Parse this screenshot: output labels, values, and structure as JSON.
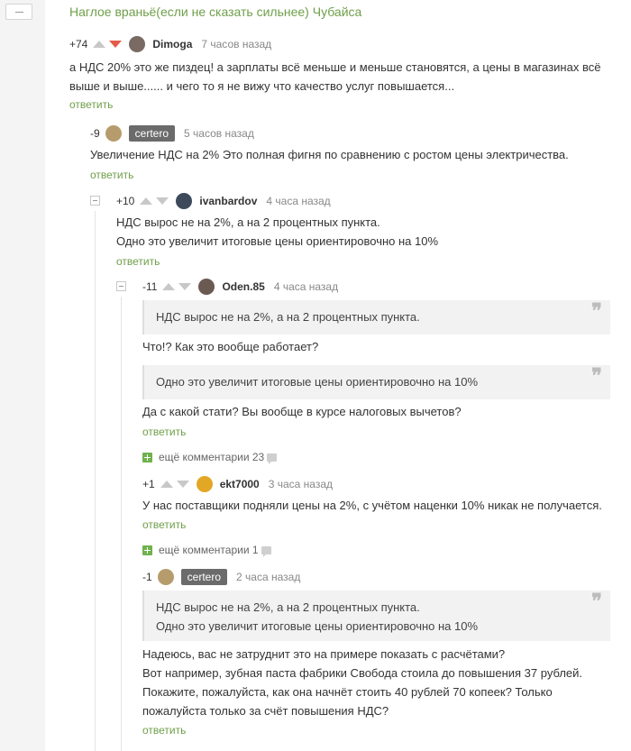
{
  "story": {
    "title": "Наглое враньё(если не сказать сильнее) Чубайса"
  },
  "ui": {
    "reply_label": "ответить",
    "more_comments_label": "ещё комментарии"
  },
  "colors": {
    "accent_green": "#6f9f4a",
    "downvote_active": "#e55b4a",
    "badge_bg": "#6b6b6b"
  },
  "icons": [
    "collapse-icon",
    "upvote-icon",
    "downvote-icon",
    "avatar",
    "quote-icon",
    "expand-plus-icon",
    "comment-bubble-icon"
  ],
  "comments": [
    {
      "rating": "+74",
      "author": "Dimoga",
      "time": "7 часов назад",
      "lines": [
        "а НДС 20% это же пиздец! а зарплаты всё меньше и меньше становятся, а цены в магазинах всё",
        "выше и выше...... и чего то я не вижу что качество услуг повышается..."
      ]
    },
    {
      "rating": "-9",
      "author": "certero",
      "time": "5 часов назад",
      "lines": [
        "Увеличение НДС на 2% Это полная фигня по сравнению с ростом цены электричества."
      ]
    },
    {
      "rating": "+10",
      "author": "ivanbardov",
      "time": "4 часа назад",
      "lines": [
        "НДС вырос не на 2%, а на 2 процентных пункта.",
        "Одно это увеличит итоговые цены ориентировочно на 10%"
      ]
    },
    {
      "rating": "-11",
      "author": "Oden.85",
      "time": "4 часа назад",
      "quote1": "НДС вырос не на 2%, а на 2 процентных пункта.",
      "text1": "Что!? Как это вообще работает?",
      "quote2": "Одно это увеличит итоговые цены ориентировочно на 10%",
      "text2": "Да с какой стати? Вы вообще в курсе налоговых вычетов?",
      "more_count": "23"
    },
    {
      "rating": "+1",
      "author": "ekt7000",
      "time": "3 часа назад",
      "lines": [
        "У нас поставщики подняли цены на 2%, с учётом наценки 10% никак не получается."
      ],
      "more_count": "1"
    },
    {
      "rating": "-1",
      "author": "certero",
      "time": "2 часа назад",
      "quote_lines": [
        "НДС вырос не на 2%, а на 2 процентных пункта.",
        "Одно это увеличит итоговые цены ориентировочно на 10%"
      ],
      "lines": [
        "Надеюсь, вас не затруднит это на примере показать с расчётами?",
        "Вот например, зубная паста фабрики Свобода стоила до повышения 37 рублей.",
        "Покажите, пожалуйста, как она начнёт стоить 40 рублей 70 копеек? Только",
        "пожалуйста только за счёт повышения НДС?"
      ]
    }
  ]
}
